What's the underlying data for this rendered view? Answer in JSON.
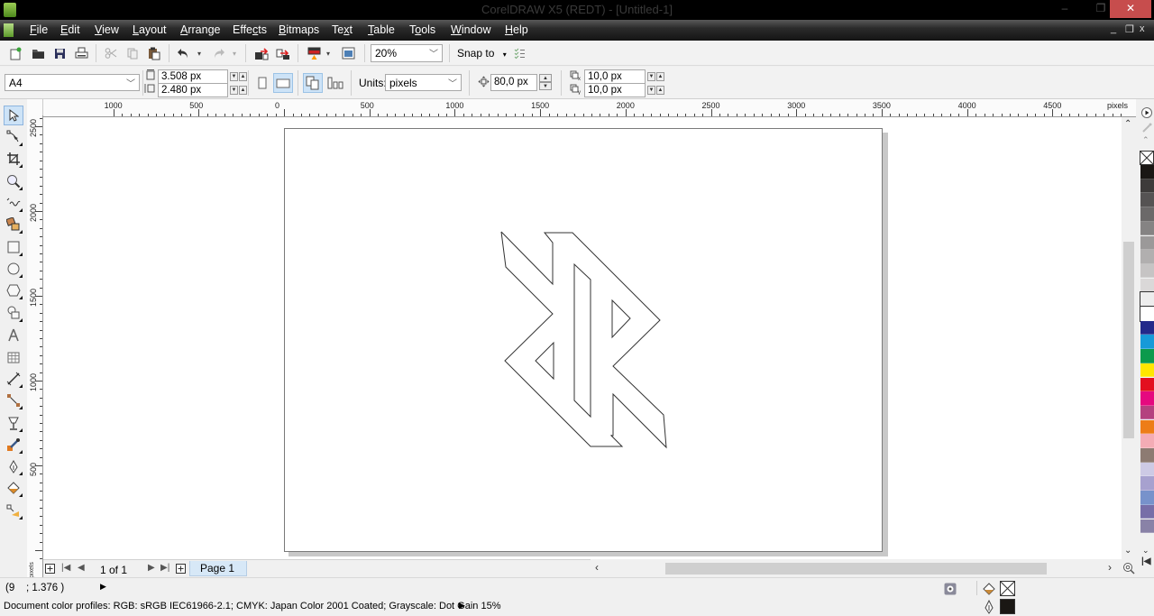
{
  "window": {
    "title": "CorelDRAW X5 (REDT) - [Untitled-1]",
    "controls": {
      "minimize": "–",
      "maximize": "❐",
      "close": "✕"
    }
  },
  "menubar": {
    "items": [
      {
        "label": "File",
        "accel": "F"
      },
      {
        "label": "Edit",
        "accel": "E"
      },
      {
        "label": "View",
        "accel": "V"
      },
      {
        "label": "Layout",
        "accel": "L"
      },
      {
        "label": "Arrange",
        "accel": "A"
      },
      {
        "label": "Effects",
        "accel": "c"
      },
      {
        "label": "Bitmaps",
        "accel": "B"
      },
      {
        "label": "Text",
        "accel": "x"
      },
      {
        "label": "Table",
        "accel": "T"
      },
      {
        "label": "Tools",
        "accel": "o"
      },
      {
        "label": "Window",
        "accel": "W"
      },
      {
        "label": "Help",
        "accel": "H"
      }
    ],
    "doc_controls": {
      "minimize": "_",
      "restore": "❐",
      "close": "x"
    }
  },
  "standard_toolbar": {
    "icons": [
      "new-icon",
      "open-icon",
      "save-icon",
      "print-icon",
      "cut-icon",
      "copy-icon",
      "paste-icon",
      "undo-icon",
      "redo-icon",
      "import-icon",
      "export-icon",
      "application-launcher-icon",
      "welcome-screen-icon"
    ],
    "zoom_level": "20%",
    "snap_to_label": "Snap to",
    "options_icon": "options-checklist-icon"
  },
  "property_bar": {
    "page_size": "A4",
    "page_width": "3.508 px",
    "page_height": "2.480 px",
    "orientation": {
      "portrait": false,
      "landscape": true
    },
    "all_pages_selected": true,
    "units_label": "Units:",
    "units_value": "pixels",
    "nudge_distance": "80,0 px",
    "duplicate_x": "10,0 px",
    "duplicate_y": "10,0 px"
  },
  "toolbox": {
    "tools": [
      {
        "name": "pick-tool",
        "active": true
      },
      {
        "name": "shape-tool"
      },
      {
        "name": "crop-tool"
      },
      {
        "name": "zoom-tool"
      },
      {
        "name": "freehand-tool"
      },
      {
        "name": "smart-fill-tool"
      },
      {
        "name": "rectangle-tool"
      },
      {
        "name": "ellipse-tool"
      },
      {
        "name": "polygon-tool"
      },
      {
        "name": "basic-shapes-tool"
      },
      {
        "name": "text-tool"
      },
      {
        "name": "table-tool"
      },
      {
        "name": "dimension-tool"
      },
      {
        "name": "connector-tool"
      },
      {
        "name": "blend-tool"
      },
      {
        "name": "eyedropper-tool"
      },
      {
        "name": "outline-pen-tool"
      },
      {
        "name": "fill-tool"
      },
      {
        "name": "interactive-fill-tool"
      }
    ]
  },
  "rulers": {
    "unit_label": "pixels",
    "horizontal_labels": [
      "1000",
      "500",
      "0",
      "500",
      "1000",
      "1500",
      "2000",
      "2500",
      "3000",
      "3500",
      "4000",
      "4500"
    ],
    "vertical_labels": [
      "2500",
      "2000",
      "1500",
      "1000",
      "500"
    ]
  },
  "page_navigation": {
    "page_count_text": "1 of 1",
    "page_tab": "Page 1"
  },
  "palette": {
    "colors": [
      "#1a1714",
      "#3d3b3a",
      "#555353",
      "#6b6969",
      "#858383",
      "#9b9999",
      "#b1afaf",
      "#c6c4c4",
      "#dad8d8",
      "#ededed",
      "#ffffff",
      "#23298a",
      "#169ad8",
      "#0c9a4c",
      "#ffe600",
      "#e3101f",
      "#e5097f",
      "#b4417f",
      "#ed7d18",
      "#f4acb5",
      "#8d7b72",
      "#cdcae5",
      "#a7a1cf",
      "#7792cb",
      "#776ea8",
      "#8982a7"
    ]
  },
  "status": {
    "cursor_position": "(9    ; 1.376 )",
    "color_profiles": "Document color profiles: RGB: sRGB IEC61966-2.1; CMYK: Japan Color 2001 Coated; Grayscale: Dot Gain 15%",
    "fill_color": "none",
    "outline_color": "#1a1714"
  },
  "drawing": {
    "object": "stylized-logo-outline",
    "stroke_color": "#333333"
  }
}
